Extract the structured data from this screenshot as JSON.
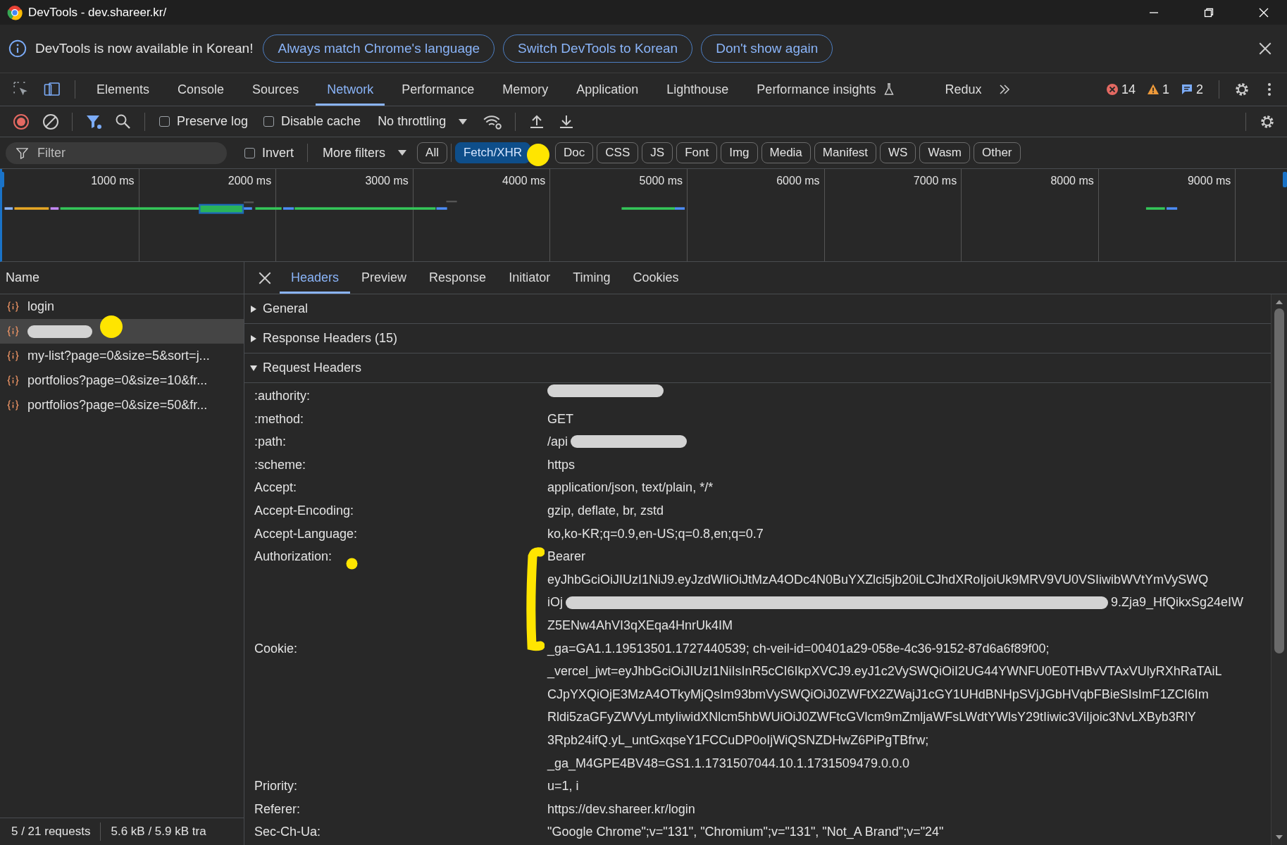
{
  "window": {
    "title": "DevTools - dev.shareer.kr/"
  },
  "infobar": {
    "message": "DevTools is now available in Korean!",
    "buttons": [
      "Always match Chrome's language",
      "Switch DevTools to Korean",
      "Don't show again"
    ]
  },
  "tabs": [
    {
      "label": "Elements",
      "selected": false
    },
    {
      "label": "Console",
      "selected": false
    },
    {
      "label": "Sources",
      "selected": false
    },
    {
      "label": "Network",
      "selected": true
    },
    {
      "label": "Performance",
      "selected": false
    },
    {
      "label": "Memory",
      "selected": false
    },
    {
      "label": "Application",
      "selected": false
    },
    {
      "label": "Lighthouse",
      "selected": false
    },
    {
      "label": "Performance insights",
      "selected": false
    },
    {
      "label": "Redux",
      "selected": false
    }
  ],
  "counts": {
    "errors": "14",
    "warnings": "1",
    "messages": "2"
  },
  "toolbar": {
    "recording": true,
    "filter_active": true,
    "preserve_log": {
      "label": "Preserve log",
      "checked": false
    },
    "disable_cache": {
      "label": "Disable cache",
      "checked": false
    },
    "throttling": "No throttling"
  },
  "filter_bar": {
    "placeholder": "Filter",
    "invert": {
      "label": "Invert",
      "checked": false
    },
    "more_filters": "More filters",
    "types": [
      {
        "label": "All",
        "selected": false
      },
      {
        "label": "Fetch/XHR",
        "selected": true
      },
      {
        "label": "Doc",
        "selected": false
      },
      {
        "label": "CSS",
        "selected": false
      },
      {
        "label": "JS",
        "selected": false
      },
      {
        "label": "Font",
        "selected": false
      },
      {
        "label": "Img",
        "selected": false
      },
      {
        "label": "Media",
        "selected": false
      },
      {
        "label": "Manifest",
        "selected": false
      },
      {
        "label": "WS",
        "selected": false
      },
      {
        "label": "Wasm",
        "selected": false
      },
      {
        "label": "Other",
        "selected": false
      }
    ]
  },
  "timeline": {
    "ticks": [
      "1000 ms",
      "2000 ms",
      "3000 ms",
      "4000 ms",
      "5000 ms",
      "6000 ms",
      "7000 ms",
      "8000 ms",
      "9000 ms"
    ]
  },
  "requests": {
    "column": "Name",
    "rows": [
      {
        "parts": [
          {
            "kind": "text",
            "text": "login"
          }
        ],
        "selected": false
      },
      {
        "parts": [
          {
            "kind": "smear-s"
          }
        ],
        "selected": true
      },
      {
        "parts": [
          {
            "kind": "text",
            "text": "my-list?page=0&size=5&sort=j..."
          }
        ],
        "selected": false
      },
      {
        "parts": [
          {
            "kind": "text",
            "text": "portfolios?page=0&size=10&fr..."
          }
        ],
        "selected": false
      },
      {
        "parts": [
          {
            "kind": "text",
            "text": "portfolios?page=0&size=50&fr..."
          }
        ],
        "selected": false
      }
    ]
  },
  "detail_tabs": [
    {
      "label": "Headers",
      "selected": true
    },
    {
      "label": "Preview",
      "selected": false
    },
    {
      "label": "Response",
      "selected": false
    },
    {
      "label": "Initiator",
      "selected": false
    },
    {
      "label": "Timing",
      "selected": false
    },
    {
      "label": "Cookies",
      "selected": false
    }
  ],
  "sections": [
    {
      "title": "General",
      "expanded": false
    },
    {
      "title": "Response Headers (15)",
      "expanded": false
    },
    {
      "title": "Request Headers",
      "expanded": true
    }
  ],
  "request_headers": [
    {
      "name": ":authority:",
      "lines": [
        [
          {
            "kind": "smear-m"
          }
        ]
      ]
    },
    {
      "name": ":method:",
      "lines": [
        [
          {
            "kind": "text",
            "text": "GET"
          }
        ]
      ]
    },
    {
      "name": ":path:",
      "lines": [
        [
          {
            "kind": "text",
            "text": "/api"
          },
          {
            "kind": "smear-m"
          }
        ]
      ]
    },
    {
      "name": ":scheme:",
      "lines": [
        [
          {
            "kind": "text",
            "text": "https"
          }
        ]
      ]
    },
    {
      "name": "Accept:",
      "lines": [
        [
          {
            "kind": "text",
            "text": "application/json, text/plain, */*"
          }
        ]
      ]
    },
    {
      "name": "Accept-Encoding:",
      "lines": [
        [
          {
            "kind": "text",
            "text": "gzip, deflate, br, zstd"
          }
        ]
      ]
    },
    {
      "name": "Accept-Language:",
      "lines": [
        [
          {
            "kind": "text",
            "text": "ko,ko-KR;q=0.9,en-US;q=0.8,en;q=0.7"
          }
        ]
      ]
    },
    {
      "name": "Authorization:",
      "lines": [
        [
          {
            "kind": "text",
            "text": "Bearer"
          }
        ],
        [
          {
            "kind": "text",
            "text": "eyJhbGciOiJIUzI1NiJ9.eyJzdWIiOiJtMzA4ODc4N0BuYXZlci5jb20iLCJhdXRoIjoiUk9MRV9VU0VSIiwibWVtYmVySWQ"
          }
        ],
        [
          {
            "kind": "text",
            "text": "iOj"
          },
          {
            "kind": "smear-l"
          },
          {
            "kind": "text",
            "text": "9.Zja9_HfQikxSg24eIW"
          }
        ],
        [
          {
            "kind": "text",
            "text": "Z5ENw4AhVI3qXEqa4HnrUk4IM"
          }
        ]
      ]
    },
    {
      "name": "Cookie:",
      "lines": [
        [
          {
            "kind": "text",
            "text": "_ga=GA1.1.19513501.1727440539; ch-veil-id=00401a29-058e-4c36-9152-87d6a6f89f00;"
          }
        ],
        [
          {
            "kind": "text",
            "text": "_vercel_jwt=eyJhbGciOiJIUzI1NiIsInR5cCI6IkpXVCJ9.eyJ1c2VySWQiOiI2UG44YWNFU0E0THBvVTAxVUlyRXhRaTAiL"
          }
        ],
        [
          {
            "kind": "text",
            "text": "CJpYXQiOjE3MzA4OTkyMjQsIm93bmVySWQiOiJ0ZWFtX2ZWajJ1cGY1UHdBNHpSVjJGbHVqbFBieSIsImF1ZCI6Im"
          }
        ],
        [
          {
            "kind": "text",
            "text": "Rldi5zaGFyZWVyLmtyIiwidXNlcm5hbWUiOiJ0ZWFtcGVlcm9mZmljaWFsLWdtYWlsY29tIiwic3ViIjoic3NvLXByb3RlY"
          }
        ],
        [
          {
            "kind": "text",
            "text": "3Rpb24ifQ.yL_untGxqseY1FCCuDP0oIjWiQSNZDHwZ6PiPgTBfrw;"
          }
        ],
        [
          {
            "kind": "text",
            "text": "_ga_M4GPE4BV48=GS1.1.1731507044.10.1.1731509479.0.0.0"
          }
        ]
      ]
    },
    {
      "name": "Priority:",
      "lines": [
        [
          {
            "kind": "text",
            "text": "u=1, i"
          }
        ]
      ]
    },
    {
      "name": "Referer:",
      "lines": [
        [
          {
            "kind": "text",
            "text": "https://dev.shareer.kr/login"
          }
        ]
      ]
    },
    {
      "name": "Sec-Ch-Ua:",
      "lines": [
        [
          {
            "kind": "text",
            "text": "\"Google Chrome\";v=\"131\", \"Chromium\";v=\"131\", \"Not_A Brand\";v=\"24\""
          }
        ]
      ]
    }
  ],
  "status_bar": {
    "requests": "5 / 21 requests",
    "transferred": "5.6 kB / 5.9 kB tra"
  }
}
